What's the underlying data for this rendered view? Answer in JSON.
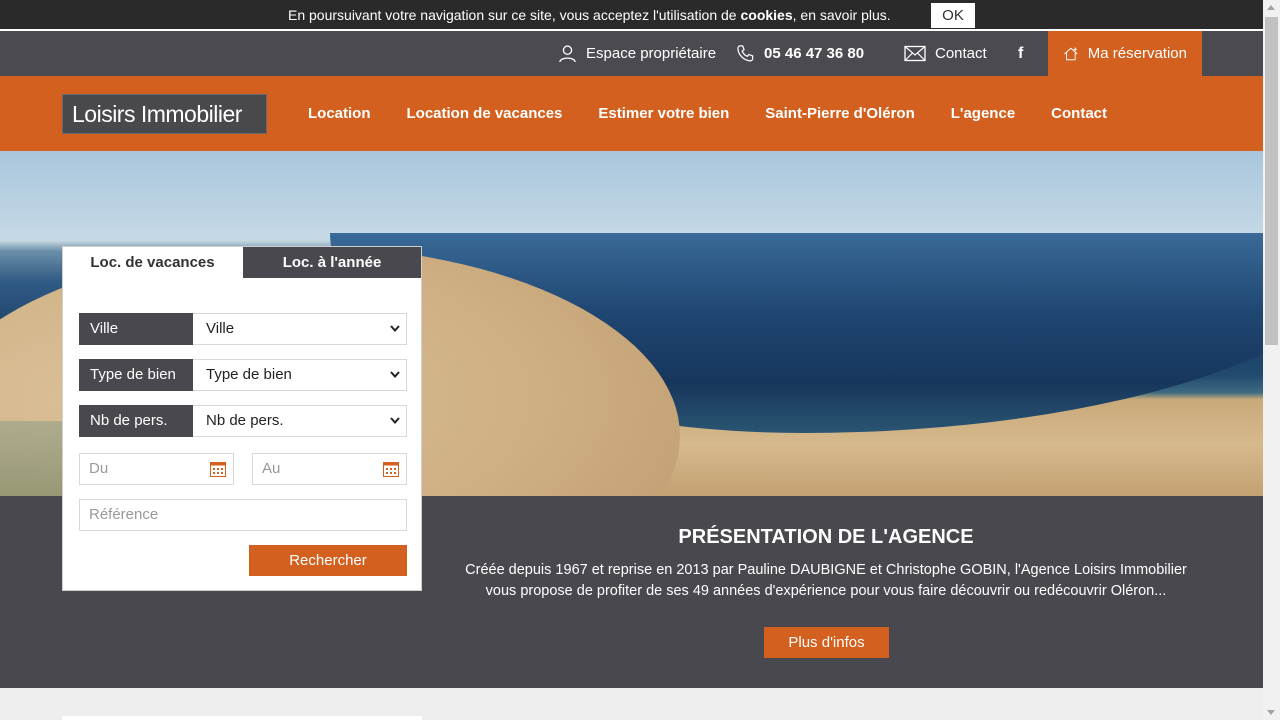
{
  "cookie_bar": {
    "text_before": "En poursuivant votre navigation sur ce site, vous acceptez l'utilisation de ",
    "text_bold": "cookies",
    "text_after": ", en savoir plus.",
    "ok_label": "OK"
  },
  "topbar": {
    "owner_space": "Espace propriétaire",
    "phone": "05 46 47 36 80",
    "contact": "Contact",
    "facebook": "f",
    "reservation": "Ma réservation"
  },
  "header": {
    "logo": "Loisirs Immobilier",
    "nav": [
      "Location",
      "Location de vacances",
      "Estimer votre bien",
      "Saint-Pierre d'Oléron",
      "L'agence",
      "Contact"
    ]
  },
  "search": {
    "tabs": [
      "Loc. de vacances",
      "Loc. à l'année"
    ],
    "fields": [
      {
        "label": "Ville",
        "value": "Ville"
      },
      {
        "label": "Type de bien",
        "value": "Type de bien"
      },
      {
        "label": "Nb de pers.",
        "value": "Nb de pers."
      }
    ],
    "date_from_placeholder": "Du",
    "date_to_placeholder": "Au",
    "reference_placeholder": "Référence",
    "submit_label": "Rechercher"
  },
  "presentation": {
    "title": "PRÉSENTATION DE L'AGENCE",
    "text_line1": "Créée depuis 1967 et reprise en 2013 par Pauline DAUBIGNE et Christophe GOBIN, l'Agence Loisirs Immobilier",
    "text_line2": "vous propose de profiter de ses 49 années d'expérience pour vous faire découvrir ou redécouvrir Oléron...",
    "button": "Plus d'infos"
  },
  "colors": {
    "accent": "#d3601f",
    "dark": "#48484e"
  }
}
